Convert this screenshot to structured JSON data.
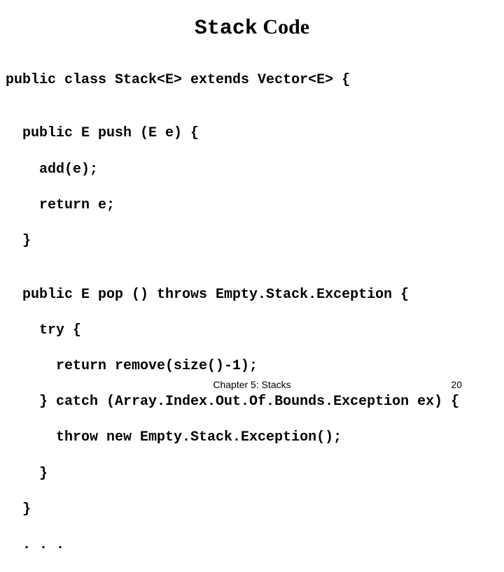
{
  "title": {
    "mono_part": "Stack",
    "serif_part": " Code"
  },
  "code": {
    "l01": "public class Stack<E> extends Vector<E> {",
    "l02": "",
    "l03": "  public E push (E e) {",
    "l04": "    add(e);",
    "l05": "    return e;",
    "l06": "  }",
    "l07": "",
    "l08": "  public E pop () throws Empty.Stack.Exception {",
    "l09": "    try {",
    "l10": "      return remove(size()-1);",
    "l11": "    } catch (Array.Index.Out.Of.Bounds.Exception ex) {",
    "l12": "      throw new Empty.Stack.Exception();",
    "l13": "    }",
    "l14": "  }",
    "l15": "  . . ."
  },
  "footer": {
    "chapter": "Chapter 5: Stacks",
    "page": "20"
  }
}
